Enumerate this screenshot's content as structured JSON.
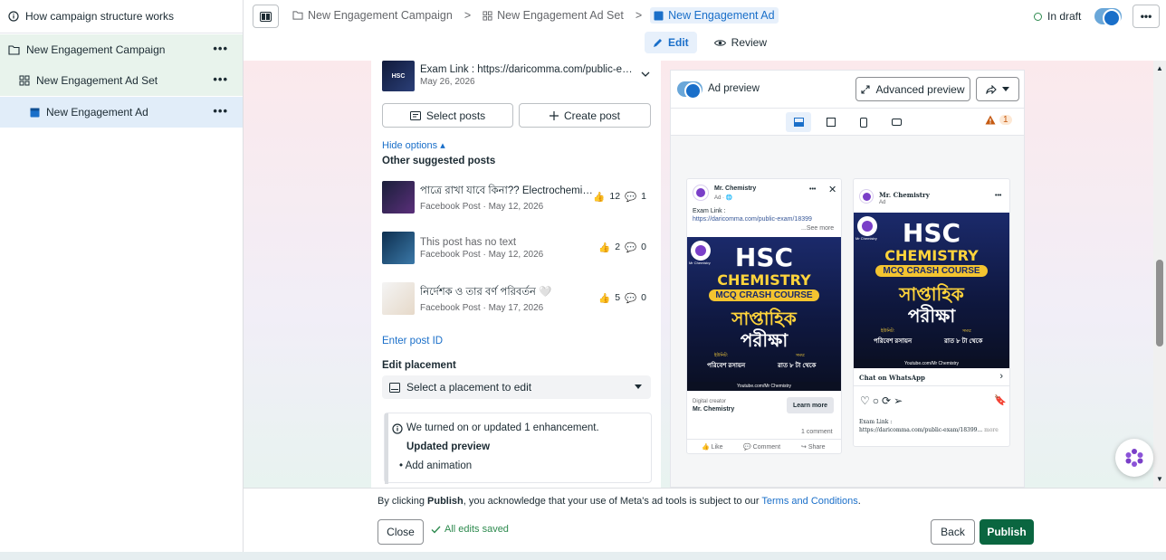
{
  "sidebar": {
    "help_label": "How campaign structure works",
    "campaign_label": "New Engagement Campaign",
    "adset_label": "New Engagement Ad Set",
    "ad_label": "New Engagement Ad",
    "more": "•••"
  },
  "topbar": {
    "crumbs": [
      "New Engagement Campaign",
      "New Engagement Ad Set",
      "New Engagement Ad"
    ],
    "separator": ">",
    "status": "In draft",
    "more": "•••",
    "edit_tab": "Edit",
    "review_tab": "Review"
  },
  "editor": {
    "post_title": "Exam Link : https://daricomma.com/public-exa...",
    "post_date": "May 26, 2026",
    "select_posts": "Select posts",
    "create_post": "Create post",
    "hide_options": "Hide options ▴",
    "suggested_heading": "Other suggested posts",
    "suggested": [
      {
        "title": "পাত্রে রাখা যাবে কিনা?? Electrochemistr...",
        "meta": "Facebook Post · May 12, 2026",
        "likes": "12",
        "comments": "1"
      },
      {
        "title": "This post has no text",
        "meta": "Facebook Post · May 12, 2026",
        "likes": "2",
        "comments": "0"
      },
      {
        "title": "নির্দেশক ও তার বর্ণ পরিবর্তন 🤍",
        "meta": "Facebook Post · May 17, 2026",
        "likes": "5",
        "comments": "0"
      }
    ],
    "enter_post_id": "Enter post ID",
    "edit_placement": "Edit placement",
    "placement_select": "Select a placement to edit",
    "notice_text": "We turned on or updated 1 enhancement.",
    "notice_heading": "Updated preview",
    "notice_item": "Add animation"
  },
  "preview": {
    "toggle_label": "Ad preview",
    "advanced_preview": "Advanced preview",
    "warning_count": "1",
    "fb_card": {
      "page_name": "Mr. Chemistry",
      "sponsored": "Ad · 🌐",
      "text_line1": "Exam Link :",
      "text_link": "https://daricomma.com/public-exam/18399",
      "see_more": "...See more",
      "creator_label": "Digital creator",
      "creator_name": "Mr. Chemistry",
      "cta": "Learn more",
      "comments": "1 comment",
      "like": "Like",
      "comment": "Comment",
      "share": "Share"
    },
    "ig_card": {
      "page_name": "Mr. Chemistry",
      "sponsored": "Ad",
      "cta": "Chat on WhatsApp",
      "caption1": "Exam Link :",
      "caption2": "https://daricomma.com/public-exam/18399...",
      "more": "more"
    },
    "creative": {
      "logo": "Mr Chemistry",
      "hsc": "HSC",
      "chemistry": "CHEMISTRY",
      "mcq": "MCQ CRASH COURSE",
      "bn1": "সাপ্তাহিক",
      "bn2": "পরীক্ষা",
      "subject_label": "ইউনিট:",
      "subject": "পরিবেশ রসায়ন",
      "time_label": "সময়:",
      "time": "রাত ৮ টা থেকে",
      "footer": "Youtube.com/Mr Chemistry"
    }
  },
  "bottombar": {
    "legal_prefix": "By clicking ",
    "legal_publish": "Publish",
    "legal_middle": ", you acknowledge that your use of Meta's ad tools is subject to our ",
    "legal_link": "Terms and Conditions",
    "legal_end": ".",
    "close": "Close",
    "saved": "All edits saved",
    "back": "Back",
    "publish": "Publish"
  }
}
